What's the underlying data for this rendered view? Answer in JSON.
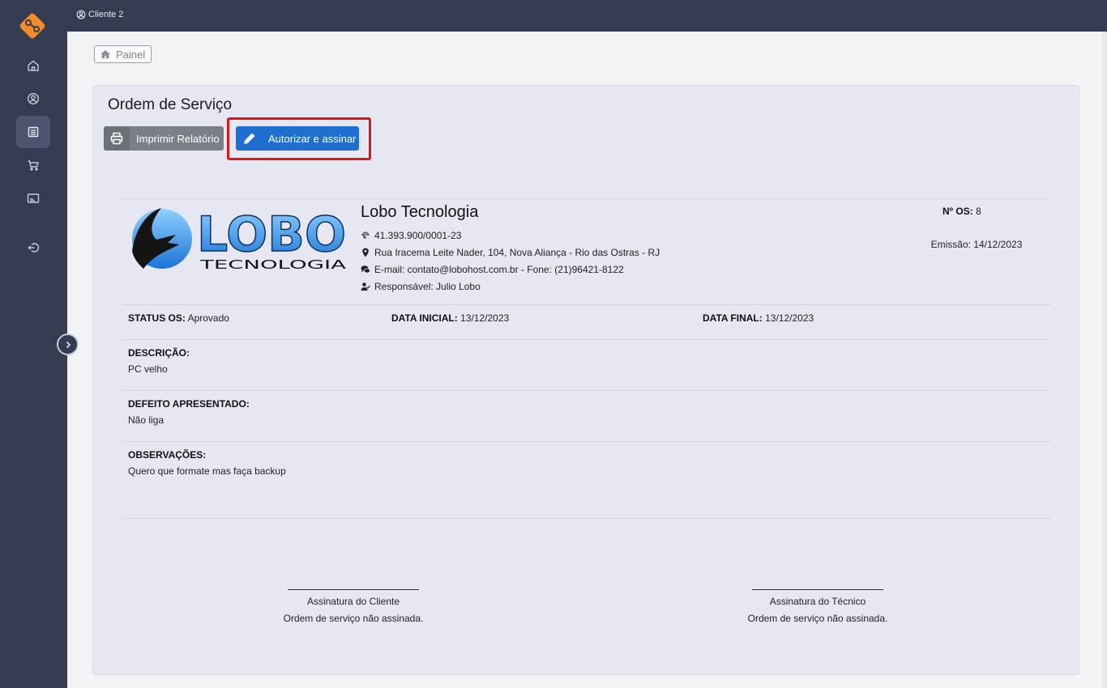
{
  "topbar": {
    "user_label": "Cliente 2"
  },
  "breadcrumb": {
    "label": "Painel"
  },
  "page": {
    "title": "Ordem de Serviço",
    "print_button": "Imprimir Relatório",
    "authorize_button": "Autorizar e assinar"
  },
  "company": {
    "name": "Lobo Tecnologia",
    "cnpj": "41.393.900/0001-23",
    "address": "Rua Iracema Leite Nader, 104, Nova Aliança - Rio das Ostras - RJ",
    "contact": "E-mail: contato@lobohost.com.br - Fone: (21)96421-8122",
    "responsible": "Responsável: Julio Lobo",
    "logo_text_main": "LOBO",
    "logo_text_sub": "TECNOLOGIA"
  },
  "os": {
    "number_label": "Nº OS:",
    "number": "8",
    "emission": "Emissão: 14/12/2023",
    "status_label": "STATUS OS:",
    "status": "Aprovado",
    "start_label": "DATA INICIAL:",
    "start": "13/12/2023",
    "end_label": "DATA FINAL:",
    "end": "13/12/2023"
  },
  "sections": {
    "description_label": "DESCRIÇÃO:",
    "description": "PC velho",
    "defect_label": "DEFEITO APRESENTADO:",
    "defect": "Não liga",
    "notes_label": "OBSERVAÇÕES:",
    "notes": "Quero que formate mas faça backup"
  },
  "signatures": {
    "client_label": "Assinatura do Cliente",
    "client_status": "Ordem de serviço não assinada.",
    "tech_label": "Assinatura do Técnico",
    "tech_status": "Ordem de serviço não assinada."
  },
  "colors": {
    "sidebar": "#353b50",
    "primary": "#1f6fd1",
    "highlight": "#e01515",
    "logo_orange": "#f28c28"
  }
}
